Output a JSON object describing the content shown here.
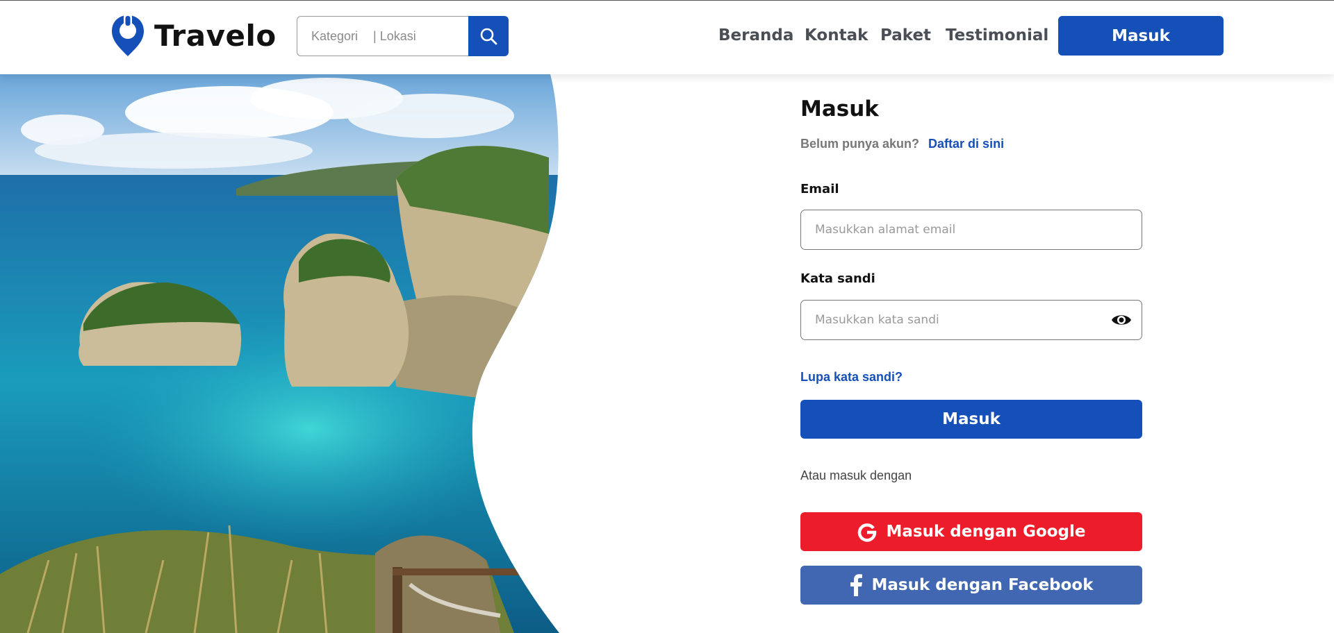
{
  "header": {
    "brand": "Travelo",
    "search": {
      "category_placeholder": "Kategori",
      "location_placeholder": "| Lokasi"
    },
    "nav": [
      "Beranda",
      "Kontak",
      "Paket",
      "Testimonial"
    ],
    "login_label": "Masuk"
  },
  "form": {
    "title": "Masuk",
    "register_question": "Belum punya akun?",
    "register_link": "Daftar di sini",
    "email_label": "Email",
    "email_placeholder": "Masukkan alamat email",
    "password_label": "Kata sandi",
    "password_placeholder": "Masukkan kata sandi",
    "forgot_label": "Lupa kata sandi?",
    "submit_label": "Masuk",
    "or_label": "Atau masuk dengan",
    "google_label": "Masuk dengan Google",
    "facebook_label": "Masuk dengan Facebook"
  },
  "colors": {
    "primary": "#1450b8",
    "google": "#ed1c2a",
    "facebook": "#4267b2"
  },
  "icons": {
    "logo": "location-pin-logo-icon",
    "search": "search-icon",
    "password_toggle": "eye-icon",
    "google": "google-g-icon",
    "facebook": "facebook-f-icon"
  }
}
